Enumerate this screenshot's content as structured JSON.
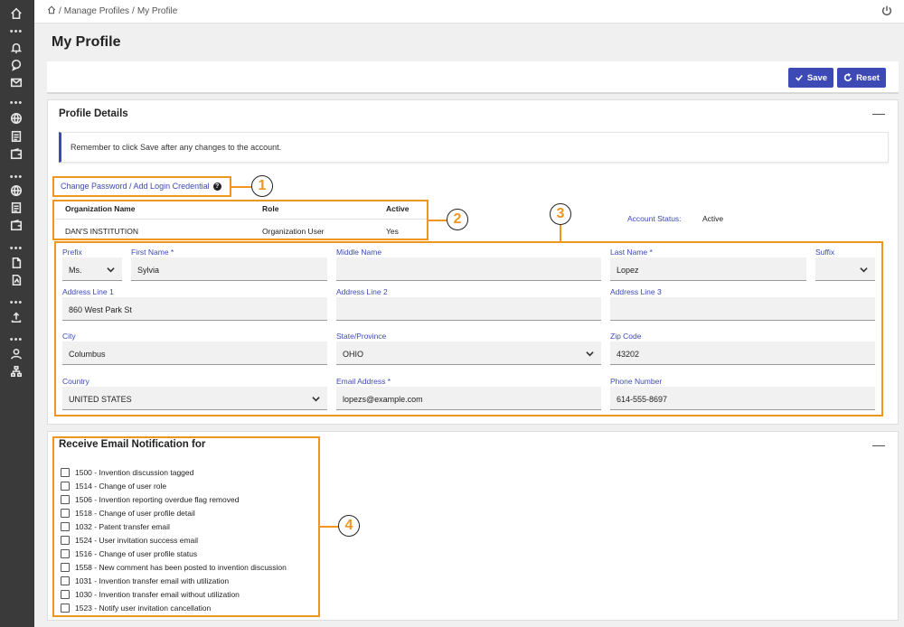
{
  "breadcrumb": {
    "items": [
      "Manage Profiles",
      "My Profile"
    ],
    "sep": "/"
  },
  "page_title": "My Profile",
  "toolbar": {
    "save_label": "Save",
    "reset_label": "Reset"
  },
  "profile_details": {
    "title": "Profile Details",
    "notice": "Remember to click Save after any changes to the account.",
    "change_password_link": "Change Password / Add Login Credential",
    "help_glyph": "?",
    "org_table": {
      "headers": [
        "Organization Name",
        "Role",
        "Active"
      ],
      "rows": [
        [
          "DAN'S INSTITUTION",
          "Organization User",
          "Yes"
        ]
      ]
    },
    "account_status_label": "Account Status:",
    "account_status_value": "Active",
    "fields": {
      "prefix": {
        "label": "Prefix",
        "value": "Ms."
      },
      "first_name": {
        "label": "First Name *",
        "value": "Sylvia"
      },
      "middle_name": {
        "label": "Middle Name",
        "value": ""
      },
      "last_name": {
        "label": "Last Name *",
        "value": "Lopez"
      },
      "suffix": {
        "label": "Suffix",
        "value": ""
      },
      "address1": {
        "label": "Address Line 1",
        "value": "860 West Park St"
      },
      "address2": {
        "label": "Address Line 2",
        "value": ""
      },
      "address3": {
        "label": "Address Line 3",
        "value": ""
      },
      "city": {
        "label": "City",
        "value": "Columbus"
      },
      "state": {
        "label": "State/Province",
        "value": "OHIO"
      },
      "zip": {
        "label": "Zip Code",
        "value": "43202"
      },
      "country": {
        "label": "Country",
        "value": "UNITED STATES"
      },
      "email": {
        "label": "Email Address *",
        "value": "lopezs@example.com"
      },
      "phone": {
        "label": "Phone Number",
        "value": "614-555-8697"
      }
    }
  },
  "email_notifications": {
    "title": "Receive Email Notification for",
    "items": [
      "1500 - Invention discussion tagged",
      "1514 - Change of user role",
      "1506 - Invention reporting overdue flag removed",
      "1518 - Change of user profile detail",
      "1032 - Patent transfer email",
      "1524 - User invitation success email",
      "1516 - Change of user profile status",
      "1558 - New comment has been posted to invention discussion",
      "1031 - Invention transfer email with utilization",
      "1030 - Invention transfer email without utilization",
      "1523 - Notify user invitation cancellation"
    ]
  },
  "callouts": [
    "1",
    "2",
    "3",
    "4"
  ],
  "collapse_glyph": "—",
  "colors": {
    "sidebar": "#3a3a3a",
    "accent": "#3d4ab6",
    "annotation": "#f0951e"
  },
  "icons": {
    "sidebar": [
      "home-icon",
      "bell-icon",
      "chat-icon",
      "mail-icon",
      "globe-icon",
      "document-icon",
      "wallet-icon",
      "globe-icon",
      "document-icon",
      "wallet-icon",
      "file-icon",
      "pdf-file-icon",
      "upload-icon",
      "user-icon",
      "org-chart-icon"
    ],
    "topbar": [
      "home-icon",
      "power-icon"
    ]
  }
}
